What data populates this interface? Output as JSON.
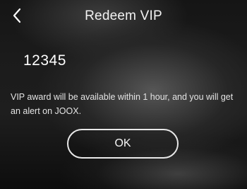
{
  "header": {
    "title": "Redeem VIP",
    "back_icon": "chevron-left-icon"
  },
  "redeem": {
    "code": "12345",
    "message": "VIP award will be available within 1 hour, and you will get an alert on JOOX."
  },
  "actions": {
    "ok_label": "OK"
  },
  "colors": {
    "text": "#ffffff",
    "background": "#1c1c1c",
    "button_border": "#e8e8e8"
  }
}
